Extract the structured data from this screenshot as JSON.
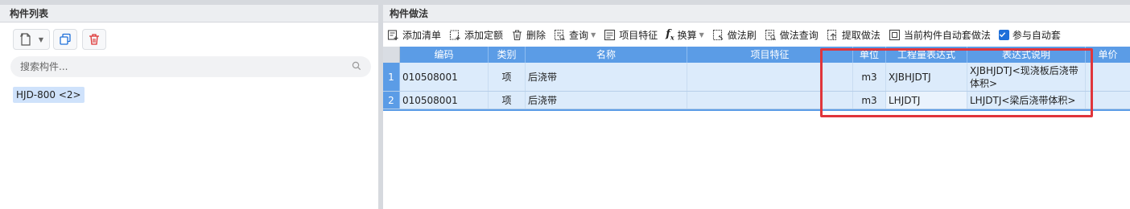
{
  "left_panel": {
    "title": "构件列表",
    "search_placeholder": "搜索构件...",
    "tag": "HJD-800 <2>"
  },
  "right_panel": {
    "title": "构件做法",
    "toolbar": [
      {
        "label": "添加清单",
        "icon": "add-list-icon"
      },
      {
        "label": "添加定额",
        "icon": "add-quota-icon"
      },
      {
        "label": "删除",
        "icon": "delete-icon"
      },
      {
        "label": "查询",
        "icon": "query-icon"
      },
      {
        "label": "项目特征",
        "icon": "feature-icon"
      },
      {
        "label": "换算",
        "icon": "fx-icon"
      },
      {
        "label": "做法刷",
        "icon": "method-brush-icon"
      },
      {
        "label": "做法查询",
        "icon": "method-query-icon"
      },
      {
        "label": "提取做法",
        "icon": "extract-icon"
      },
      {
        "label": "当前构件自动套做法",
        "icon": "auto-apply-icon"
      },
      {
        "label": "参与自动套",
        "icon": "checkbox-icon"
      }
    ],
    "columns": [
      "编码",
      "类别",
      "名称",
      "项目特征",
      "单位",
      "工程量表达式",
      "表达式说明",
      "单价"
    ],
    "rows": [
      {
        "num": "1",
        "code": "010508001",
        "type": "项",
        "name": "后浇带",
        "feature": "",
        "unit": "m3",
        "expr": "XJBHJDTJ",
        "desc": "XJBHJDTJ<现浇板后浇带体积>"
      },
      {
        "num": "2",
        "code": "010508001",
        "type": "项",
        "name": "后浇带",
        "feature": "",
        "unit": "m3",
        "expr": "LHJDTJ",
        "desc": "LHJDTJ<梁后浇带体积>"
      }
    ]
  },
  "colors": {
    "header_blue": "#5b9ce6",
    "row_bg": "#dcebfb",
    "highlight": "#e0353b"
  }
}
